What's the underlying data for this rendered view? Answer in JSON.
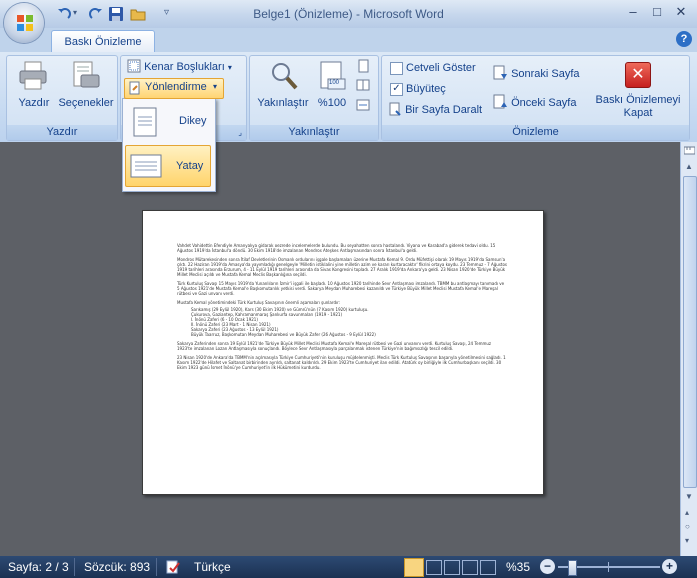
{
  "window": {
    "title": "Belge1 (Önizleme) - Microsoft Word"
  },
  "tabs": {
    "active": "Baskı Önizleme"
  },
  "ribbon": {
    "yazdir_group": {
      "label": "Yazdır",
      "print_label": "Yazdır",
      "options_label": "Seçenekler"
    },
    "page_setup_group": {
      "margins_label": "Kenar Boşlukları",
      "orientation_label": "Yönlendirme"
    },
    "zoom_group": {
      "label": "Yakınlaştır",
      "zoom_label": "Yakınlaştır",
      "hundred_label": "%100",
      "hundred_icon_text": "100"
    },
    "preview_group": {
      "label": "Önizleme",
      "show_ruler": "Cetveli Göster",
      "magnifier": "Büyüteç",
      "shrink_one_page": "Bir Sayfa Daralt",
      "next_page": "Sonraki Sayfa",
      "prev_page": "Önceki Sayfa",
      "close_line1": "Baskı Önizlemeyi",
      "close_line2": "Kapat"
    }
  },
  "orientation_menu": {
    "portrait": "Dikey",
    "landscape": "Yatay"
  },
  "document": {
    "p1": "Vahdet Vahidettin Efendiyle Amanyalıya gidarak oezrede incelemelerde bulundu. Bu seyahatten sonra hastalandı. Viyana ve Karabad'a giderek tedavi oldu. 15 Ağustos 1919'da İstanbul'a döndü. 30 Ekim 1918'de imzalanan Mondros Ateşkes Antlaşmasından sonra İstanbul'a geldi.",
    "p2": "Mondros Mütarekesinden sonra İtilaf Devletlerinin Osmanlı ordularını işgale başlamaları üzerine Mustafa Kemal 9. Ordu Müfettişi olarak 19 Mayıs 1919'da Samsun'a çıktı. 22 Haziran 1919'da Amasya'da yayımladığı genelgeyle 'Milletin istiklalini yine milletin azim ve kararı kurtaracaktır' fikrini ortaya koydu. 23 Temmuz - 7 Ağustos 1919 tarihleri arasında Erzurum, 4 - 11 Eylül 1919 tarihleri arasında da Sivas Kongresini topladı. 27 Aralık 1919'da Ankara'ya geldi. 23 Nisan 1920'de Türkiye Büyük Millet Meclisi açıldı ve Mustafa Kemal Meclis Başkanlığına seçildi.",
    "p3": "Türk Kurtuluş Savaşı 15 Mayıs 1919'da Yunanlıların İzmir'i işgali ile başladı. 10 Ağustos 1920 tarihinde Sevr Antlaşması imzalandı. TBMM bu antlaşmayı tanımadı ve 5 Ağustos 1921'de Mustafa Kemal'e Başkomutanlık yetkisi verdi. Sakarya Meydan Muharebesi kazanıldı ve Türkiye Büyük Millet Meclisi Mustafa Kemal'e Mareşal rütbesi ve Gazi unvanı verdi.",
    "p4": "Mustafa Kemal yönetimindeki Türk Kurtuluş Savaşının önemli aşamaları şunlardır:",
    "list": [
      "Sarıkamış (29 Eylül 1920), Kars (30 Ekim 1920) ve Gümrü'nün (7 Kasım 1920) kurtuluşu.",
      "Çukurova, Gaziantep, Kahramanmaraş Şanlıurfa savunmaları (1919 - 1921)",
      "I. İnönü Zaferi (6 - 10 Ocak 1921)",
      "II. İnönü Zaferi (23 Mart - 1 Nisan 1921)",
      "Sakarya Zaferi (23 Ağustos - 13 Eylül 1921)",
      "Büyük Taarruz, Başkomutan Meydan Muharebesi ve Büyük Zafer (26 Ağustos - 9 Eylül 1922)"
    ],
    "p5": "Sakarya Zaferinden sonra 19 Eylül 1921'de Türkiye Büyük Millet Meclisi Mustafa Kemal'e Mareşal rütbesi ve Gazi unvanını verdi. Kurtuluş Savaşı, 24 Temmuz 1923'te imzalanan Lozan Antlaşmasıyla sonuçlandı. Böylece Sevr Antlaşmasıyla parçalanmak istenen Türkiye'nin bağımsızlığı tescil edildi.",
    "p6": "23 Nisan 1920'de Ankara'da TBMM'nin açılmasıyla Türkiye Cumhuriyeti'nin kuruluşu müjdelenmişti. Meclis Türk Kurtuluş Savaşının başarıyla yönetilmesini sağladı. 1 Kasım 1922'de Hilafet ve Saltanat birbirinden ayrıldı, saltanat kaldırıldı. 29 Ekim 1923'te Cumhuriyet ilan edildi. Atatürk oy birliğiyle ilk Cumhurbaşkanı seçildi. 30 Ekim 1923 günü İsmet İnönü'ye Cumhuriyet'in ilk Hükümetini kurdurdu."
  },
  "statusbar": {
    "page": "Sayfa: 2 / 3",
    "words": "Sözcük: 893",
    "language": "Türkçe",
    "zoom": "%35"
  },
  "colors": {
    "accent": "#15428b",
    "highlight": "#ffd473",
    "close_red": "#d32a2a"
  }
}
